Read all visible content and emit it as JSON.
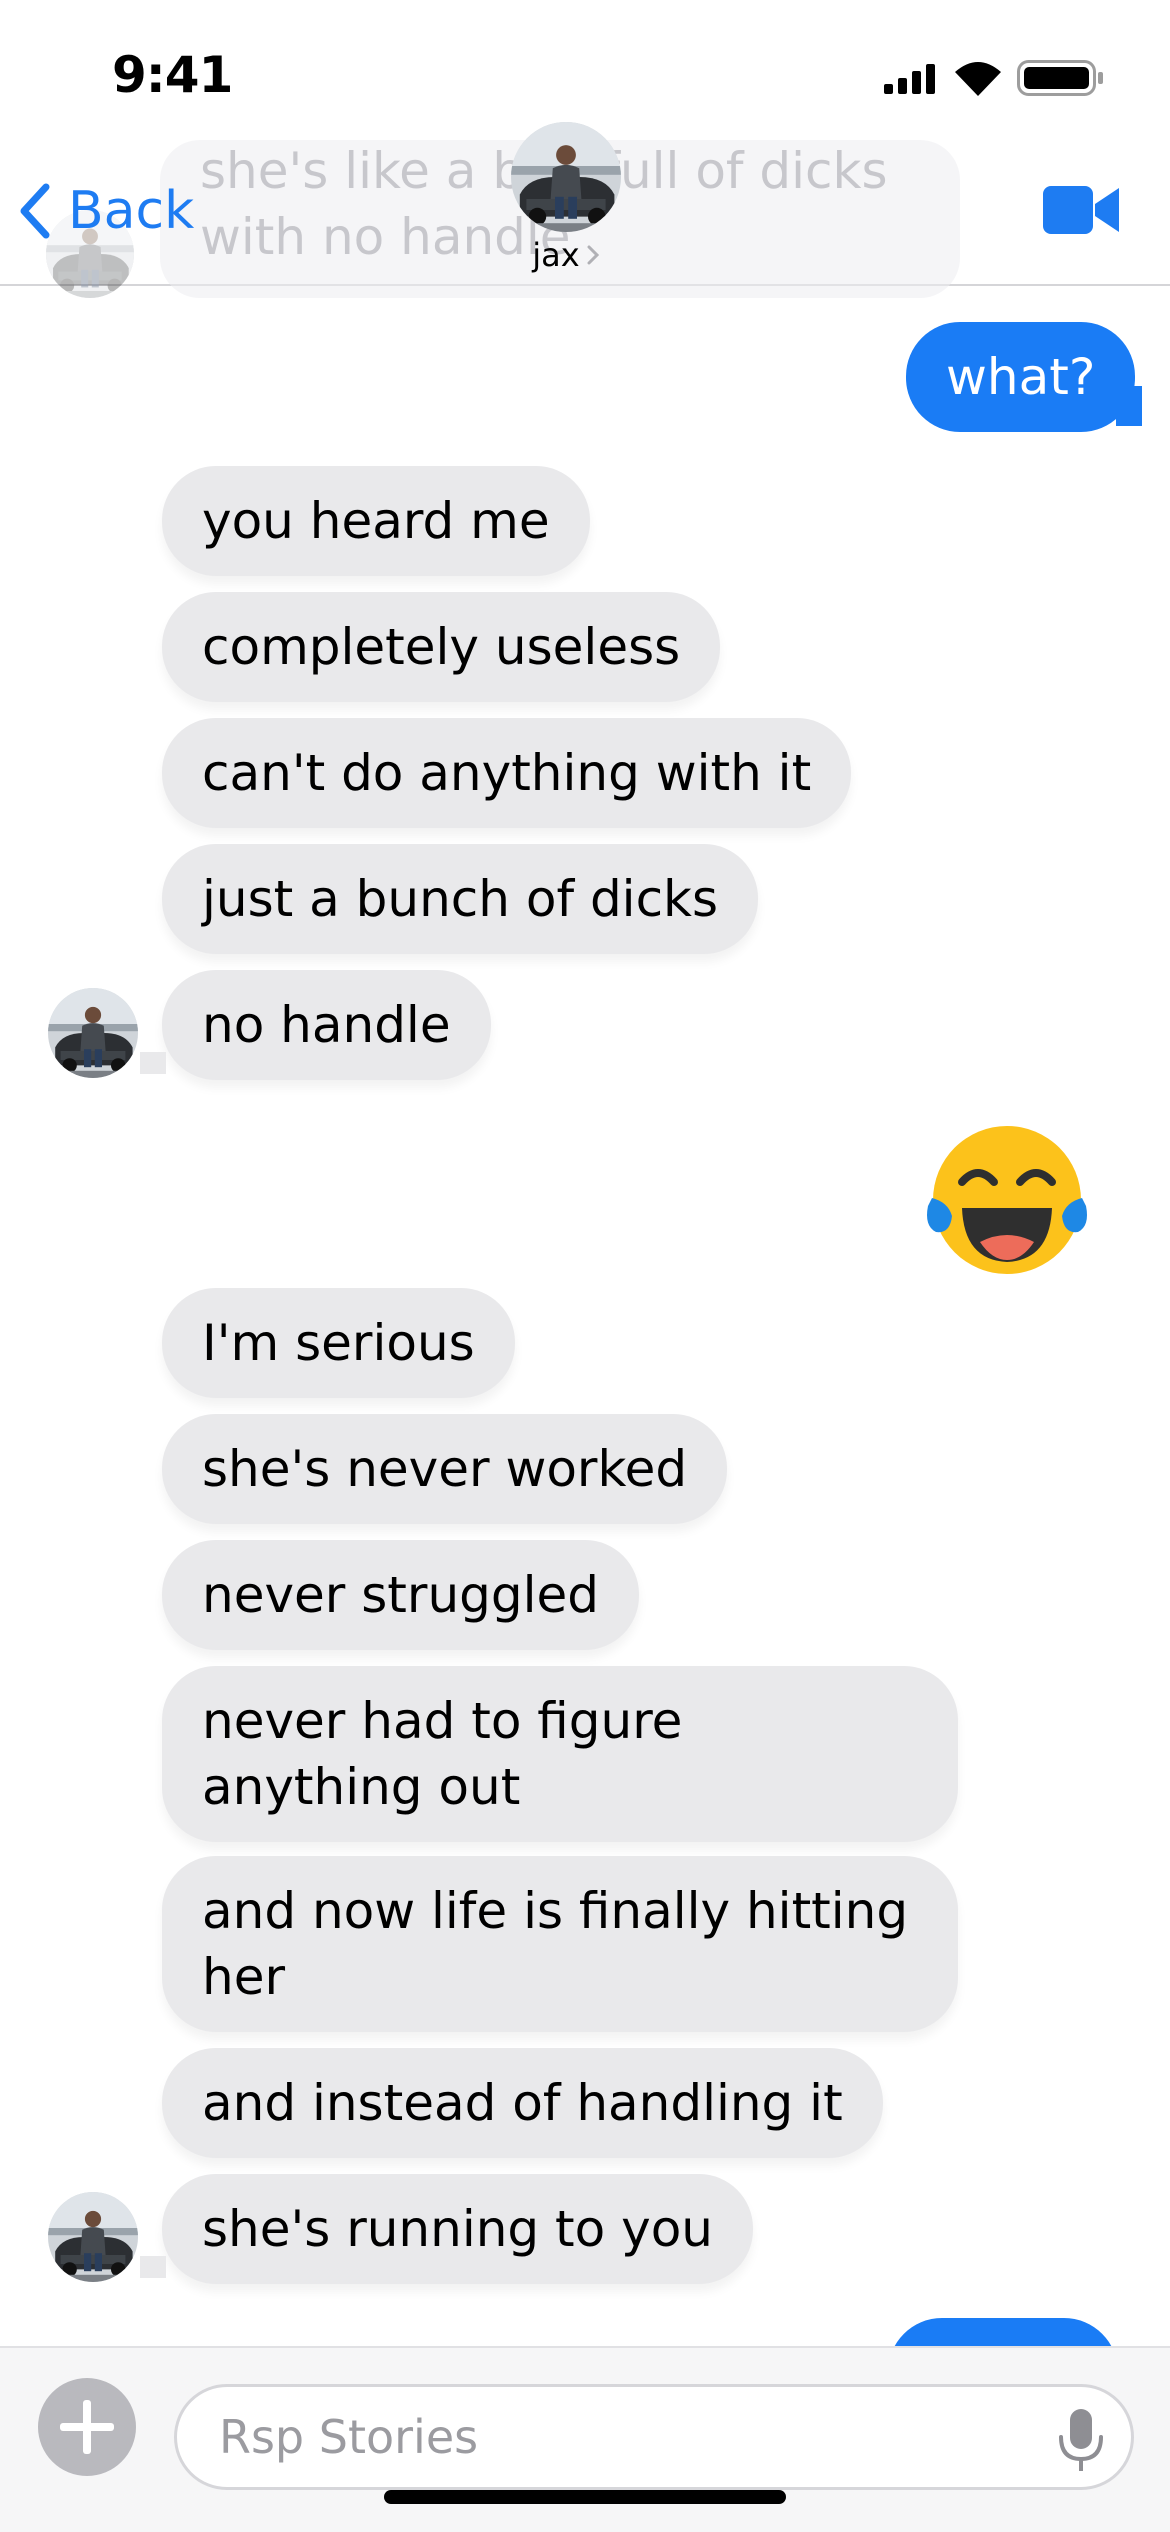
{
  "status_bar": {
    "time": "9:41"
  },
  "nav": {
    "back_label": "Back",
    "contact_name": "jax",
    "ghost_message": "she's like a bag full of dicks with no handle"
  },
  "messages": [
    {
      "sender": "me",
      "text": "what?"
    },
    {
      "sender": "jax",
      "text": "you heard me"
    },
    {
      "sender": "jax",
      "text": "completely useless"
    },
    {
      "sender": "jax",
      "text": "can't do anything with it"
    },
    {
      "sender": "jax",
      "text": "just a bunch of dicks"
    },
    {
      "sender": "jax",
      "text": "no handle"
    },
    {
      "sender": "me",
      "text": "😂",
      "emoji_icon": "face-with-tears-of-joy-icon"
    },
    {
      "sender": "jax",
      "text": "I'm serious"
    },
    {
      "sender": "jax",
      "text": "she's never worked"
    },
    {
      "sender": "jax",
      "text": "never struggled"
    },
    {
      "sender": "jax",
      "text": "never had to figure anything out"
    },
    {
      "sender": "jax",
      "text": "and now life is finally hitting her"
    },
    {
      "sender": "jax",
      "text": "and instead of handling it"
    },
    {
      "sender": "jax",
      "text": "she's running to you"
    }
  ],
  "input": {
    "placeholder": "Rsp Stories"
  },
  "colors": {
    "accent": "#1e7cf2",
    "outgoing_bubble": "#1a7cf5",
    "incoming_bubble": "#e9e9eb",
    "placeholder": "#9b9ba0"
  },
  "icons": {
    "back": "chevron-left-icon",
    "video": "video-camera-icon",
    "add": "plus-circle-icon",
    "mic": "microphone-icon",
    "signal": "cellular-signal-icon",
    "wifi": "wifi-icon",
    "battery": "battery-icon"
  }
}
